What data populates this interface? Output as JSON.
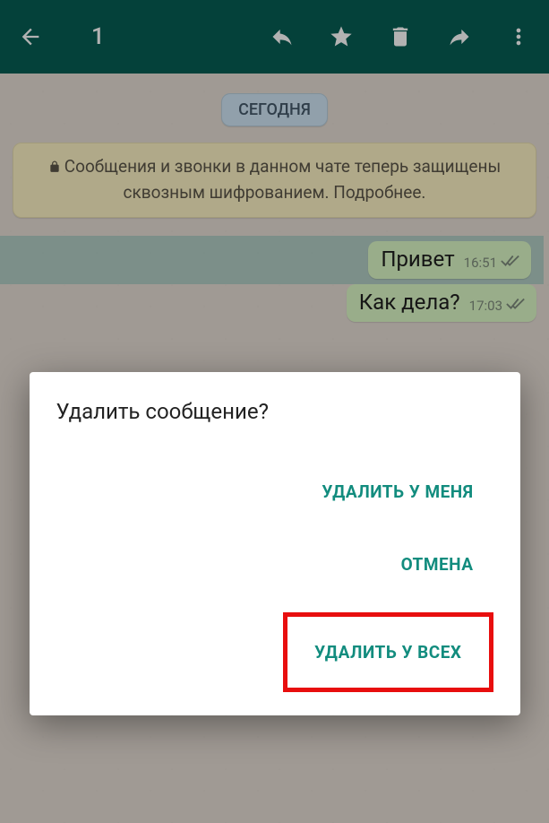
{
  "toolbar": {
    "selection_count": "1"
  },
  "chat": {
    "date_label": "СЕГОДНЯ",
    "encryption_text": "Сообщения и звонки в данном чате теперь защищены сквозным шифрованием. Подробнее."
  },
  "messages": [
    {
      "text": "Привет",
      "time": "16:51",
      "selected": true
    },
    {
      "text": "Как дела?",
      "time": "17:03",
      "selected": false
    }
  ],
  "dialog": {
    "title": "Удалить сообщение?",
    "delete_for_me": "УДАЛИТЬ У МЕНЯ",
    "cancel": "ОТМЕНА",
    "delete_for_all": "УДАЛИТЬ У ВСЕХ"
  }
}
